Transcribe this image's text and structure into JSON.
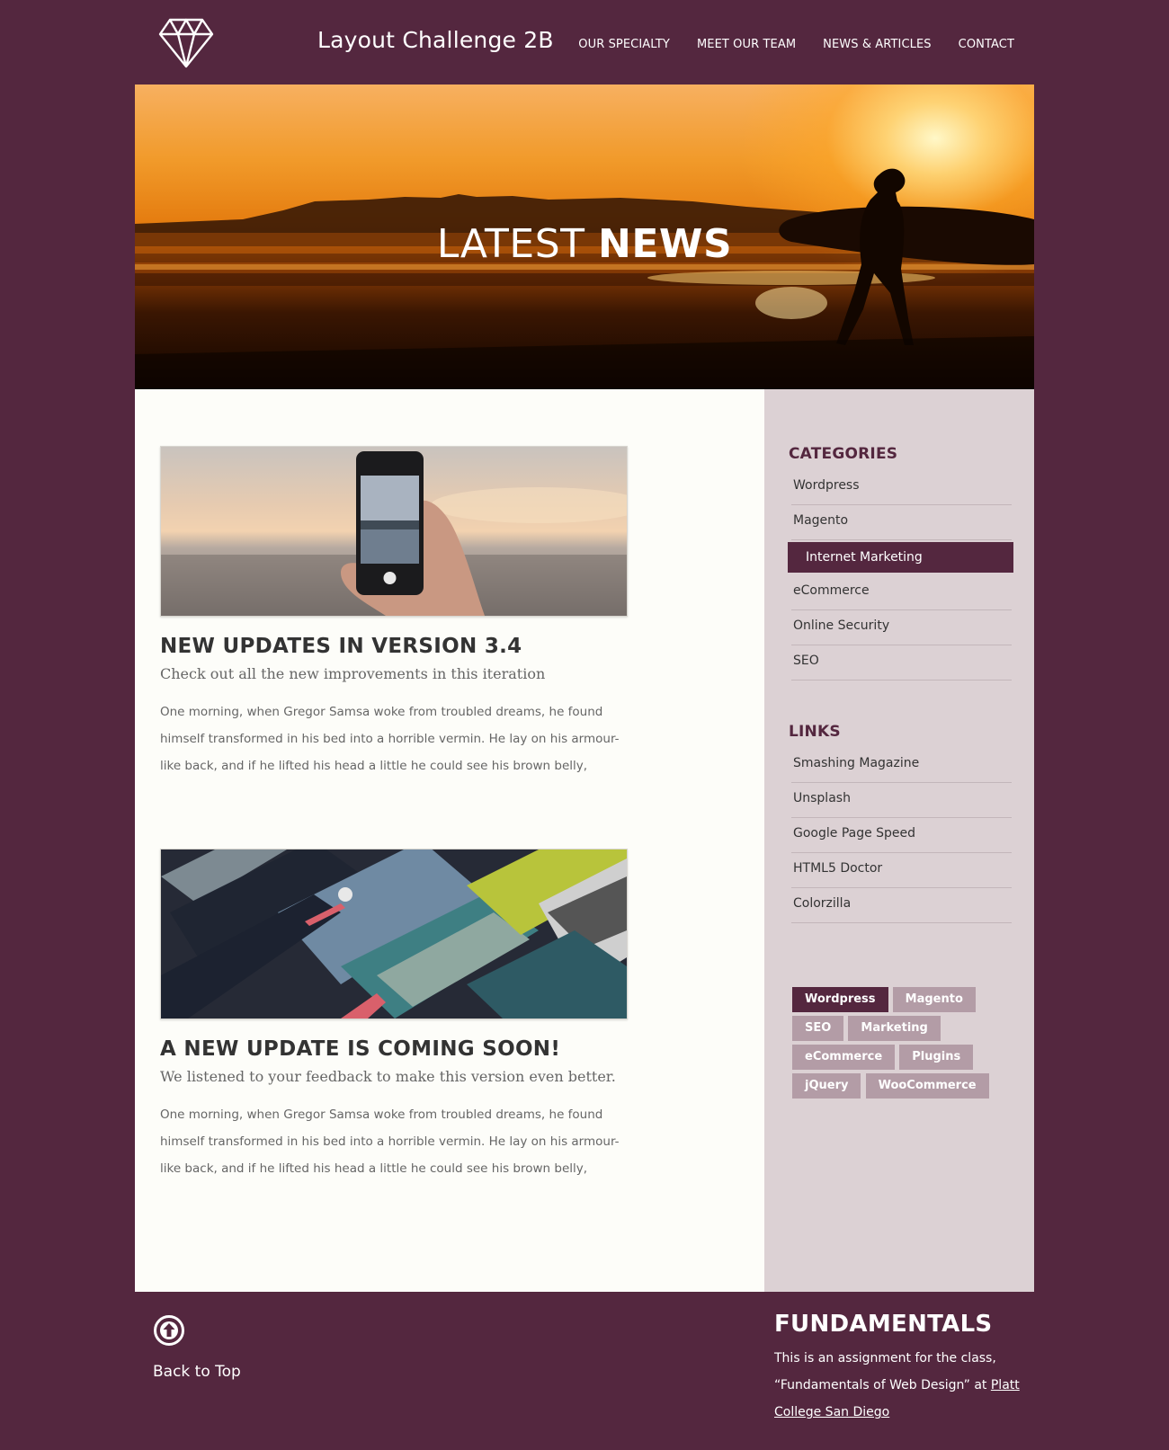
{
  "header": {
    "title": "Layout Challenge 2B",
    "logo_icon": "diamond-icon",
    "nav": [
      {
        "label": "OUR SPECIALTY"
      },
      {
        "label": "MEET OUR TEAM"
      },
      {
        "label": "NEWS & ARTICLES"
      },
      {
        "label": "CONTACT"
      }
    ]
  },
  "hero": {
    "title_light": "LATEST ",
    "title_bold": "NEWS"
  },
  "posts": [
    {
      "title": "NEW UPDATES IN VERSION 3.4",
      "subtitle": "Check out all the new improvements in this iteration",
      "body": "One morning, when Gregor Samsa woke from troubled dreams, he found himself transformed in his bed into a horrible vermin. He lay on his armour-like back, and if he lifted his head a little he could see his brown belly,"
    },
    {
      "title": "A NEW UPDATE IS COMING SOON!",
      "subtitle": "We listened to your feedback to make this version even better.",
      "body": "One morning, when Gregor Samsa woke from troubled dreams, he found himself transformed in his bed into a horrible vermin. He lay on his armour-like back, and if he lifted his head a little he could see his brown belly,"
    }
  ],
  "sidebar": {
    "categories_heading": "CATEGORIES",
    "categories": [
      {
        "label": "Wordpress"
      },
      {
        "label": "Magento"
      },
      {
        "label": "Internet Marketing"
      },
      {
        "label": "eCommerce"
      },
      {
        "label": "Online Security"
      },
      {
        "label": "SEO"
      }
    ],
    "active_category": "Internet Marketing",
    "links_heading": "LINKS",
    "links": [
      {
        "label": "Smashing Magazine"
      },
      {
        "label": "Unsplash"
      },
      {
        "label": "Google Page Speed"
      },
      {
        "label": "HTML5 Doctor"
      },
      {
        "label": "Colorzilla"
      }
    ],
    "tags": [
      {
        "label": "Wordpress"
      },
      {
        "label": "Magento"
      },
      {
        "label": "SEO"
      },
      {
        "label": "Marketing"
      },
      {
        "label": "eCommerce"
      },
      {
        "label": "Plugins"
      },
      {
        "label": "jQuery"
      },
      {
        "label": "WooCommerce"
      }
    ],
    "active_tag": "Wordpress"
  },
  "footer": {
    "back_to_top": "Back to Top",
    "back_icon": "arrow-up-circle-icon",
    "heading": "FUNDAMENTALS",
    "text_before": "This is an assignment for the class, “Fundamentals of Web Design” at ",
    "link_text": "Platt College San Diego"
  },
  "colors": {
    "brand": "#54273f",
    "sidebar_bg": "#dcd1d4",
    "tag_bg": "#b39ca6",
    "content_bg": "#fdfdf9"
  }
}
